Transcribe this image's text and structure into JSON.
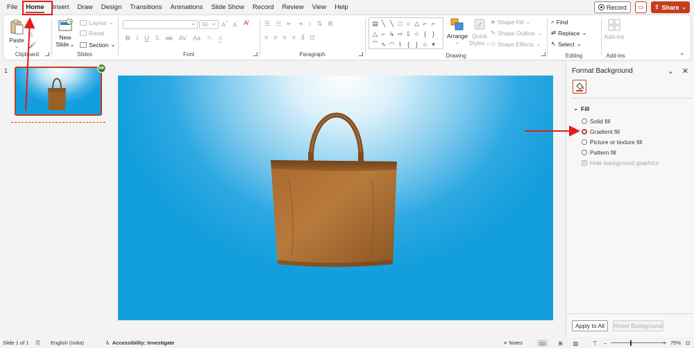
{
  "tabs": [
    "File",
    "Home",
    "Insert",
    "Draw",
    "Design",
    "Transitions",
    "Animations",
    "Slide Show",
    "Record",
    "Review",
    "View",
    "Help"
  ],
  "active_tab": "Home",
  "header_buttons": {
    "record": "Record",
    "share": "Share"
  },
  "ribbon": {
    "clipboard": {
      "label": "Clipboard",
      "paste": "Paste"
    },
    "slides": {
      "label": "Slides",
      "new_slide_line1": "New",
      "new_slide_line2": "Slide",
      "layout": "Layout",
      "reset": "Reset",
      "section": "Section"
    },
    "font": {
      "label": "Font",
      "font_name": "",
      "font_size": "60"
    },
    "paragraph": {
      "label": "Paragraph"
    },
    "drawing": {
      "label": "Drawing",
      "arrange": "Arrange",
      "quick_styles_line1": "Quick",
      "quick_styles_line2": "Styles",
      "shape_fill": "Shape Fill",
      "shape_outline": "Shape Outline",
      "shape_effects": "Shape Effects"
    },
    "editing": {
      "label": "Editing",
      "find": "Find",
      "replace": "Replace",
      "select": "Select"
    },
    "addins": {
      "label": "Add-ins",
      "button": "Add-ins"
    }
  },
  "thumbnails": [
    {
      "number": "1",
      "avatar": "MK"
    }
  ],
  "format_background": {
    "title": "Format Background",
    "section": "Fill",
    "options": [
      {
        "label": "Solid fill",
        "selected": false
      },
      {
        "label": "Gradient fill",
        "selected": true
      },
      {
        "label": "Picture or texture fill",
        "selected": false
      },
      {
        "label": "Pattern fill",
        "selected": false
      }
    ],
    "hide_graphics": "Hide background graphics",
    "apply_all": "Apply to All",
    "reset_background": "Reset Background"
  },
  "status": {
    "slide_info": "Slide 1 of 1",
    "language": "English (India)",
    "accessibility": "Accessibility: Investigate",
    "notes": "Notes",
    "zoom": "75%",
    "zoom_level": 0.35
  },
  "colors": {
    "accent": "#c43e1c",
    "annotation": "#e21b1b",
    "slide_blue": "#139fdc"
  }
}
